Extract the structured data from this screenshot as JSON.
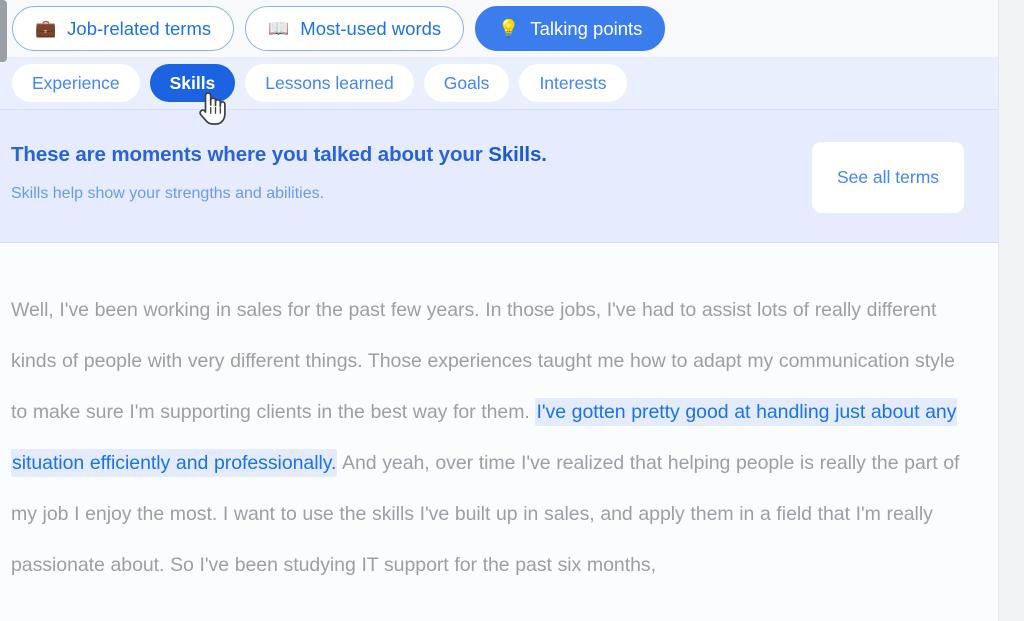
{
  "categories": [
    {
      "label": "Job-related terms",
      "icon": "briefcase-icon",
      "emoji": "💼",
      "active": false
    },
    {
      "label": "Most-used words",
      "icon": "open-book-icon",
      "emoji": "📖",
      "active": false
    },
    {
      "label": "Talking points",
      "icon": "lightbulb-icon",
      "emoji": "💡",
      "active": true
    }
  ],
  "tabs": [
    {
      "label": "Experience",
      "active": false
    },
    {
      "label": "Skills",
      "active": true
    },
    {
      "label": "Lessons learned",
      "active": false
    },
    {
      "label": "Goals",
      "active": false
    },
    {
      "label": "Interests",
      "active": false
    }
  ],
  "info": {
    "title_prefix": "These are moments where you talked about your ",
    "title_strong": "Skills.",
    "subtitle": "Skills help show your strengths and abilities.",
    "see_all_label": "See all terms"
  },
  "transcript": {
    "segments": [
      {
        "text": "Well, I've been working in sales for the past few years. In those jobs, I've had to assist lots of really different kinds of people with very different things. Those experiences taught me how to adapt my communication style to make sure I'm supporting clients in the best way for them. ",
        "highlighted": false
      },
      {
        "text": "I've gotten pretty good at handling just about any situation efficiently and professionally.",
        "highlighted": true
      },
      {
        "text": " And yeah, over time I've realized that helping people is really the part of my job I enjoy the most. I want to use the skills I've built up in sales, and apply them in a field that I'm really passionate about. So I've been studying IT support for the past six months,",
        "highlighted": false
      }
    ]
  },
  "colors": {
    "accent_blue": "#1a73e8",
    "active_pill_blue": "#3b7ded",
    "active_tab_blue": "#1b63e0",
    "tab_band_bg": "#e9effc",
    "info_band_bg": "#e6ecfd",
    "highlight_bg": "#e3ebfd",
    "transcript_text": "#9aa0a6"
  }
}
